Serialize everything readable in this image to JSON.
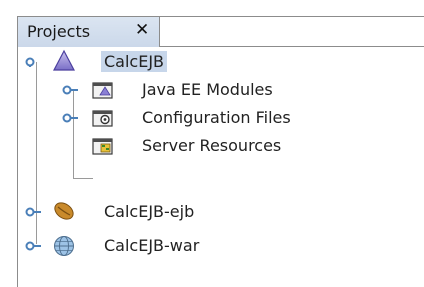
{
  "tab": {
    "label": "Projects",
    "close_glyph": "✕"
  },
  "tree": {
    "root": {
      "label": "CalcEJB",
      "icon": "enterprise-app-icon",
      "expanded": true,
      "selected": true,
      "children": [
        {
          "label": "Java EE Modules",
          "icon": "modules-folder-icon",
          "expandable": true
        },
        {
          "label": "Configuration Files",
          "icon": "config-folder-icon",
          "expandable": true
        },
        {
          "label": "Server Resources",
          "icon": "server-resources-icon",
          "expandable": false
        }
      ]
    },
    "projects": [
      {
        "label": "CalcEJB-ejb",
        "icon": "ejb-bean-icon",
        "expandable": true
      },
      {
        "label": "CalcEJB-war",
        "icon": "web-globe-icon",
        "expandable": true
      }
    ]
  },
  "colors": {
    "selection": "#c7d6ea",
    "tab_bg": "#d3dfee",
    "toggle": "#4a7fb8"
  }
}
